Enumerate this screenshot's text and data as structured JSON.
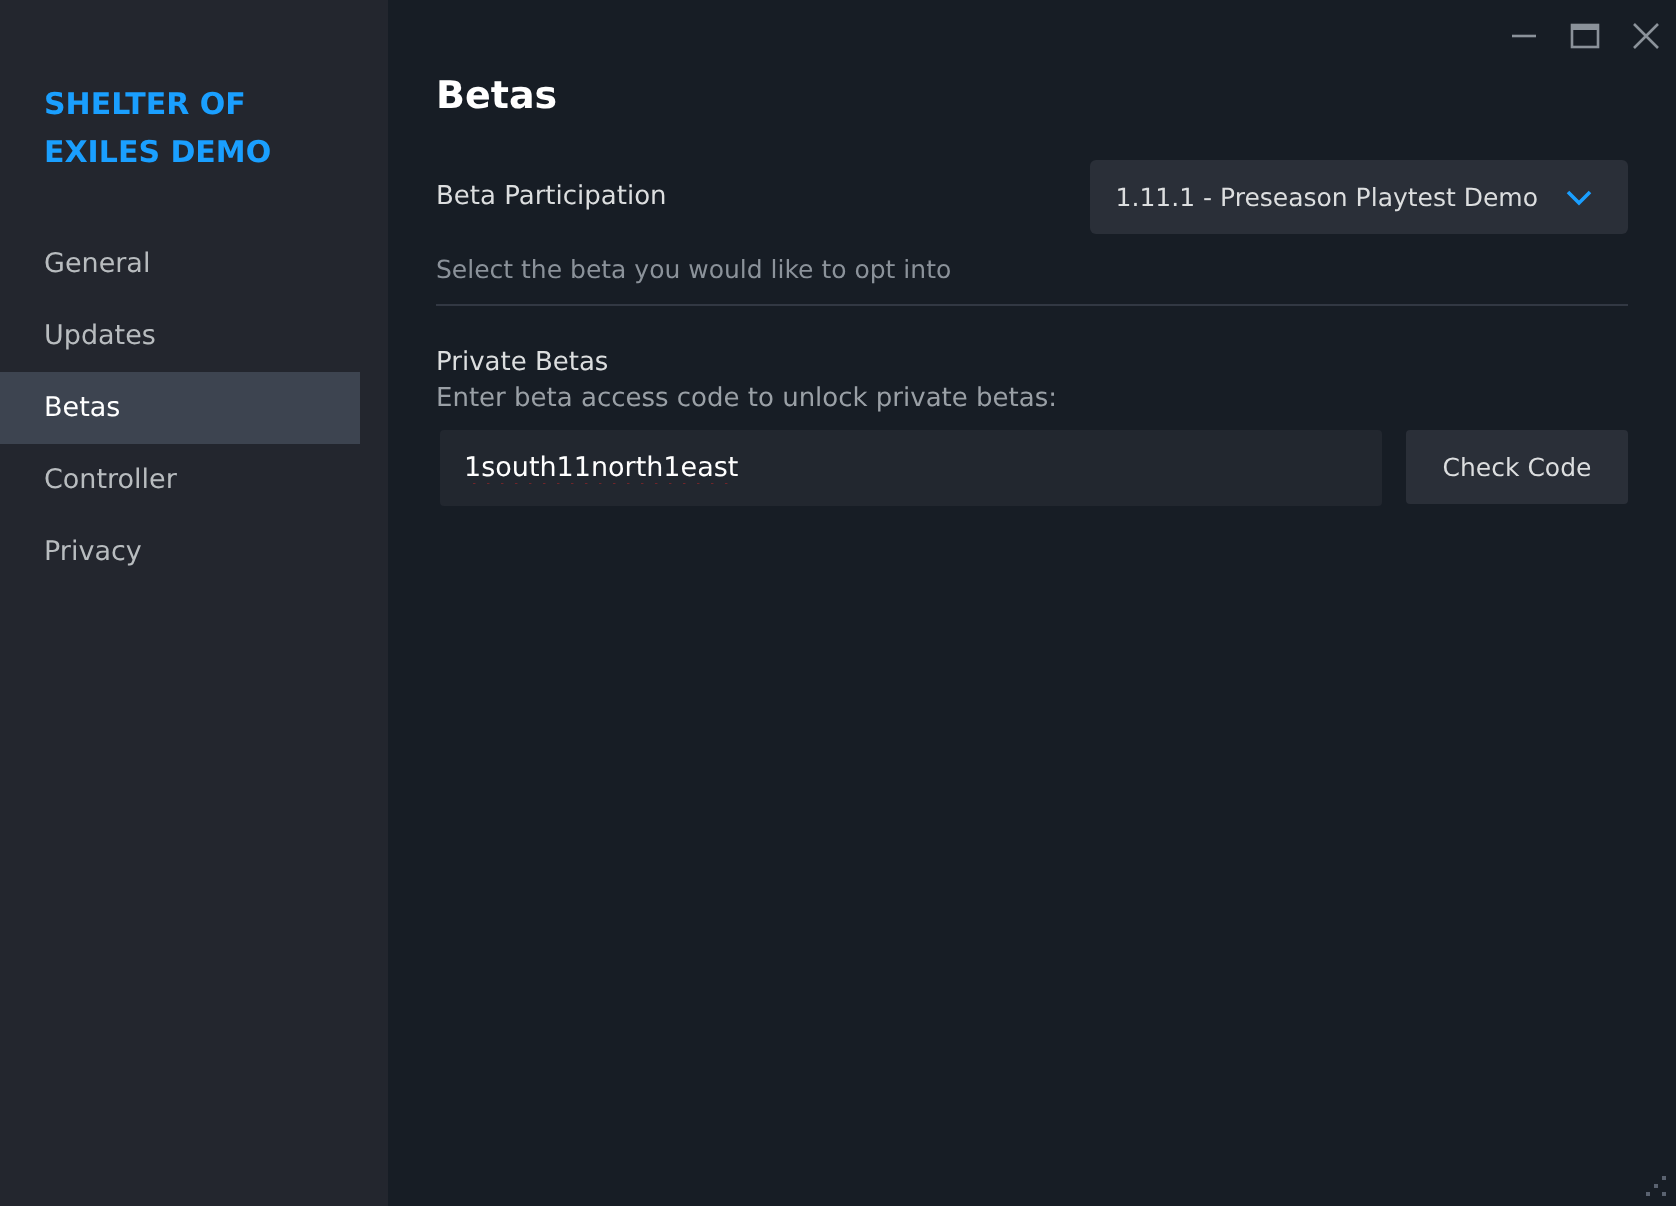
{
  "sidebar": {
    "title": "SHELTER OF EXILES DEMO",
    "items": [
      {
        "label": "General",
        "selected": false
      },
      {
        "label": "Updates",
        "selected": false
      },
      {
        "label": "Betas",
        "selected": true
      },
      {
        "label": "Controller",
        "selected": false
      },
      {
        "label": "Privacy",
        "selected": false
      }
    ]
  },
  "page": {
    "title": "Betas",
    "beta_participation": {
      "label": "Beta Participation",
      "dropdown_value": "1.11.1 - Preseason Playtest Demo",
      "hint": "Select the beta you would like to opt into"
    },
    "private_betas": {
      "label": "Private Betas",
      "description": "Enter beta access code to unlock private betas:",
      "code_field": {
        "value": "1south11north1east"
      },
      "button": "Check Code"
    }
  }
}
